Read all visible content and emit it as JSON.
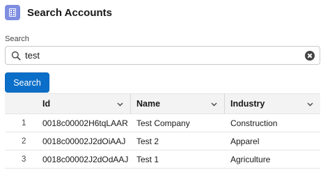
{
  "header": {
    "title": "Search Accounts",
    "icon": "building-icon",
    "icon_color": "#7f8de1"
  },
  "search": {
    "label": "Search",
    "value": "test",
    "icon": "search-icon"
  },
  "actions": {
    "search_button": "Search",
    "accent": "#0b6fc9"
  },
  "table": {
    "columns": [
      "Id",
      "Name",
      "Industry"
    ],
    "rows": [
      {
        "num": "1",
        "id": "0018c00002H6tqLAAR",
        "name": "Test Company",
        "industry": "Construction"
      },
      {
        "num": "2",
        "id": "0018c00002J2dOiAAJ",
        "name": "Test 2",
        "industry": "Apparel"
      },
      {
        "num": "3",
        "id": "0018c00002J2dOdAAJ",
        "name": "Test 1",
        "industry": "Agriculture"
      }
    ]
  }
}
